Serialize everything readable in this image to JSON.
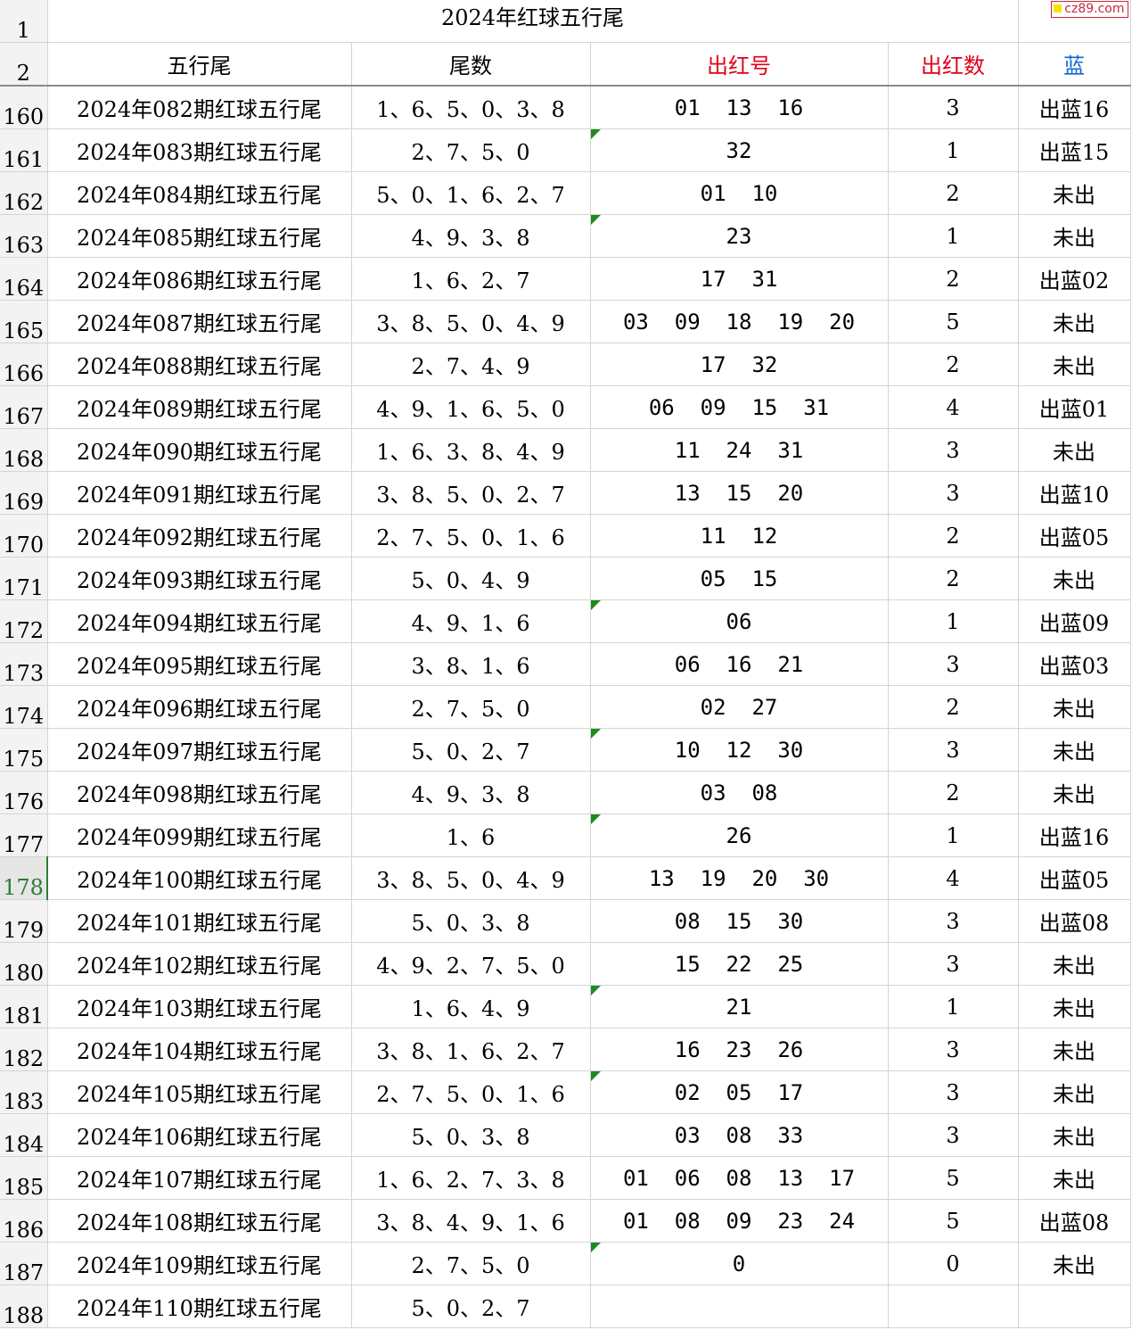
{
  "watermark": "cz89.com",
  "title": "2024年红球五行尾",
  "title_row_num": "1",
  "header_row_num": "2",
  "headers": {
    "name": "五行尾",
    "tail": "尾数",
    "red_balls": "出红号",
    "red_count": "出红数",
    "blue": "蓝"
  },
  "colors": {
    "red": "#e0001a",
    "blue": "#1266d6",
    "flag": "#1f8a1f",
    "active_row": "#2e7d32"
  },
  "rows": [
    {
      "num": "160",
      "name": "2024年082期红球五行尾",
      "tail": "1、6、5、0、3、8",
      "red": "01  13  16",
      "count": "3",
      "blue": "出蓝16",
      "flag": false
    },
    {
      "num": "161",
      "name": "2024年083期红球五行尾",
      "tail": "2、7、5、0",
      "red": "32",
      "count": "1",
      "blue": "出蓝15",
      "flag": true
    },
    {
      "num": "162",
      "name": "2024年084期红球五行尾",
      "tail": "5、0、1、6、2、7",
      "red": "01  10",
      "count": "2",
      "blue": "未出",
      "flag": false
    },
    {
      "num": "163",
      "name": "2024年085期红球五行尾",
      "tail": "4、9、3、8",
      "red": "23",
      "count": "1",
      "blue": "未出",
      "flag": true
    },
    {
      "num": "164",
      "name": "2024年086期红球五行尾",
      "tail": "1、6、2、7",
      "red": "17  31",
      "count": "2",
      "blue": "出蓝02",
      "flag": false
    },
    {
      "num": "165",
      "name": "2024年087期红球五行尾",
      "tail": "3、8、5、0、4、9",
      "red": "03  09  18  19  20",
      "count": "5",
      "blue": "未出",
      "flag": false
    },
    {
      "num": "166",
      "name": "2024年088期红球五行尾",
      "tail": "2、7、4、9",
      "red": "17  32",
      "count": "2",
      "blue": "未出",
      "flag": false
    },
    {
      "num": "167",
      "name": "2024年089期红球五行尾",
      "tail": "4、9、1、6、5、0",
      "red": "06  09  15  31",
      "count": "4",
      "blue": "出蓝01",
      "flag": false
    },
    {
      "num": "168",
      "name": "2024年090期红球五行尾",
      "tail": "1、6、3、8、4、9",
      "red": "11  24  31",
      "count": "3",
      "blue": "未出",
      "flag": false
    },
    {
      "num": "169",
      "name": "2024年091期红球五行尾",
      "tail": "3、8、5、0、2、7",
      "red": "13  15  20",
      "count": "3",
      "blue": "出蓝10",
      "flag": false
    },
    {
      "num": "170",
      "name": "2024年092期红球五行尾",
      "tail": "2、7、5、0、1、6",
      "red": "11  12",
      "count": "2",
      "blue": "出蓝05",
      "flag": false
    },
    {
      "num": "171",
      "name": "2024年093期红球五行尾",
      "tail": "5、0、4、9",
      "red": "05  15",
      "count": "2",
      "blue": "未出",
      "flag": false
    },
    {
      "num": "172",
      "name": "2024年094期红球五行尾",
      "tail": "4、9、1、6",
      "red": "06",
      "count": "1",
      "blue": "出蓝09",
      "flag": true
    },
    {
      "num": "173",
      "name": "2024年095期红球五行尾",
      "tail": "3、8、1、6",
      "red": "06  16  21",
      "count": "3",
      "blue": "出蓝03",
      "flag": false
    },
    {
      "num": "174",
      "name": "2024年096期红球五行尾",
      "tail": "2、7、5、0",
      "red": "02  27",
      "count": "2",
      "blue": "未出",
      "flag": false
    },
    {
      "num": "175",
      "name": "2024年097期红球五行尾",
      "tail": "5、0、2、7",
      "red": "10  12  30",
      "count": "3",
      "blue": "未出",
      "flag": true
    },
    {
      "num": "176",
      "name": "2024年098期红球五行尾",
      "tail": "4、9、3、8",
      "red": "03  08",
      "count": "2",
      "blue": "未出",
      "flag": false
    },
    {
      "num": "177",
      "name": "2024年099期红球五行尾",
      "tail": "1、6",
      "red": "26",
      "count": "1",
      "blue": "出蓝16",
      "flag": true
    },
    {
      "num": "178",
      "name": "2024年100期红球五行尾",
      "tail": "3、8、5、0、4、9",
      "red": "13  19  20  30",
      "count": "4",
      "blue": "出蓝05",
      "flag": false,
      "active": true
    },
    {
      "num": "179",
      "name": "2024年101期红球五行尾",
      "tail": "5、0、3、8",
      "red": "08  15  30",
      "count": "3",
      "blue": "出蓝08",
      "flag": false
    },
    {
      "num": "180",
      "name": "2024年102期红球五行尾",
      "tail": "4、9、2、7、5、0",
      "red": "15  22  25",
      "count": "3",
      "blue": "未出",
      "flag": false
    },
    {
      "num": "181",
      "name": "2024年103期红球五行尾",
      "tail": "1、6、4、9",
      "red": "21",
      "count": "1",
      "blue": "未出",
      "flag": true
    },
    {
      "num": "182",
      "name": "2024年104期红球五行尾",
      "tail": "3、8、1、6、2、7",
      "red": "16  23  26",
      "count": "3",
      "blue": "未出",
      "flag": false
    },
    {
      "num": "183",
      "name": "2024年105期红球五行尾",
      "tail": "2、7、5、0、1、6",
      "red": "02  05  17",
      "count": "3",
      "blue": "未出",
      "flag": true
    },
    {
      "num": "184",
      "name": "2024年106期红球五行尾",
      "tail": "5、0、3、8",
      "red": "03  08  33",
      "count": "3",
      "blue": "未出",
      "flag": false
    },
    {
      "num": "185",
      "name": "2024年107期红球五行尾",
      "tail": "1、6、2、7、3、8",
      "red": "01  06  08  13  17",
      "count": "5",
      "blue": "未出",
      "flag": false
    },
    {
      "num": "186",
      "name": "2024年108期红球五行尾",
      "tail": "3、8、4、9、1、6",
      "red": "01  08  09  23  24",
      "count": "5",
      "blue": "出蓝08",
      "flag": false
    },
    {
      "num": "187",
      "name": "2024年109期红球五行尾",
      "tail": "2、7、5、0",
      "red": "0",
      "count": "0",
      "blue": "未出",
      "flag": true
    },
    {
      "num": "188",
      "name": "2024年110期红球五行尾",
      "tail": "5、0、2、7",
      "red": "",
      "count": "",
      "blue": "",
      "flag": false
    }
  ]
}
